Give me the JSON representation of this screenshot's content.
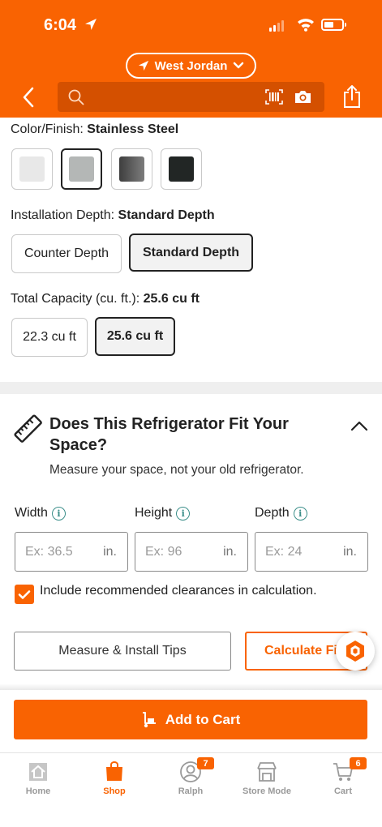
{
  "status_bar": {
    "time": "6:04"
  },
  "header": {
    "store_name": "West Jordan",
    "search_placeholder": ""
  },
  "options": {
    "color": {
      "label": "Color/Finish: ",
      "value": "Stainless Steel",
      "swatches": [
        {
          "name": "white",
          "color": "#e8e8e8",
          "selected": false
        },
        {
          "name": "stainless-steel",
          "color": "#b4b7b6",
          "selected": true
        },
        {
          "name": "black-stainless",
          "color": "#5a5a5a",
          "selected": false
        },
        {
          "name": "black",
          "color": "#222625",
          "selected": false
        }
      ]
    },
    "depth": {
      "label": "Installation Depth: ",
      "value": "Standard Depth",
      "choices": [
        "Counter Depth",
        "Standard Depth"
      ],
      "selected_index": 1
    },
    "capacity": {
      "label": "Total Capacity (cu. ft.): ",
      "value": "25.6 cu ft",
      "choices": [
        "22.3 cu ft",
        "25.6 cu ft"
      ],
      "selected_index": 1
    }
  },
  "fit_section": {
    "title": "Does This Refrigerator Fit Your Space?",
    "subtitle": "Measure your space, not your old refrigerator.",
    "fields": [
      {
        "label": "Width",
        "placeholder": "Ex: 36.5",
        "unit": "in."
      },
      {
        "label": "Height",
        "placeholder": "Ex: 96",
        "unit": "in."
      },
      {
        "label": "Depth",
        "placeholder": "Ex: 24",
        "unit": "in."
      }
    ],
    "include_clearances": {
      "label": "Include recommended clearances in calculation.",
      "checked": true
    },
    "tips_button": "Measure & Install Tips",
    "calculate_button": "Calculate Fit"
  },
  "add_to_cart": "Add to Cart",
  "tab_bar": [
    {
      "label": "Home",
      "icon": "home-icon",
      "active": false,
      "badge": ""
    },
    {
      "label": "Shop",
      "icon": "shop-bag-icon",
      "active": true,
      "badge": ""
    },
    {
      "label": "Ralph",
      "icon": "profile-icon",
      "active": false,
      "badge": "7"
    },
    {
      "label": "Store Mode",
      "icon": "store-icon",
      "active": false,
      "badge": ""
    },
    {
      "label": "Cart",
      "icon": "cart-icon",
      "active": false,
      "badge": "6"
    }
  ],
  "colors": {
    "brand_orange": "#f96302",
    "info_teal": "#3c8f8a"
  }
}
